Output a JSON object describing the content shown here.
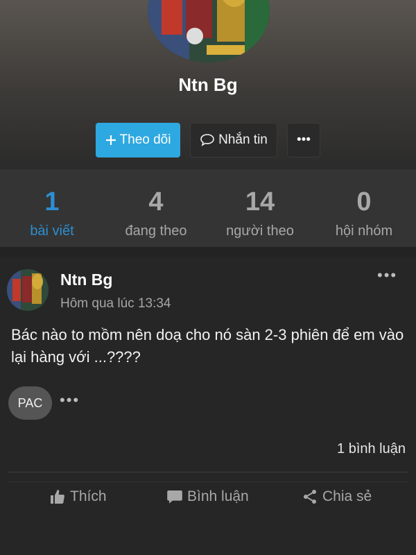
{
  "profile": {
    "name": "Ntn Bg",
    "follow_label": "Theo dõi",
    "message_label": "Nhắn tin",
    "more_label": "•••"
  },
  "stats": [
    {
      "number": "1",
      "label": "bài viết"
    },
    {
      "number": "4",
      "label": "đang theo"
    },
    {
      "number": "14",
      "label": "người theo"
    },
    {
      "number": "0",
      "label": "hội nhóm"
    }
  ],
  "post": {
    "author": "Ntn Bg",
    "time": "Hôm qua lúc 13:34",
    "menu_label": "•••",
    "content": "Bác nào to mồm nên doạ cho nó sàn 2-3 phiên để em vào lại hàng với ...????",
    "tag": "PAC",
    "tag_more": "•••",
    "comment_count": "1 bình luận",
    "actions": {
      "like": "Thích",
      "comment": "Bình luận",
      "share": "Chia sẻ"
    }
  },
  "colors": {
    "accent": "#2ea8e0",
    "active_stat": "#2e8ed0",
    "background": "#232323"
  }
}
